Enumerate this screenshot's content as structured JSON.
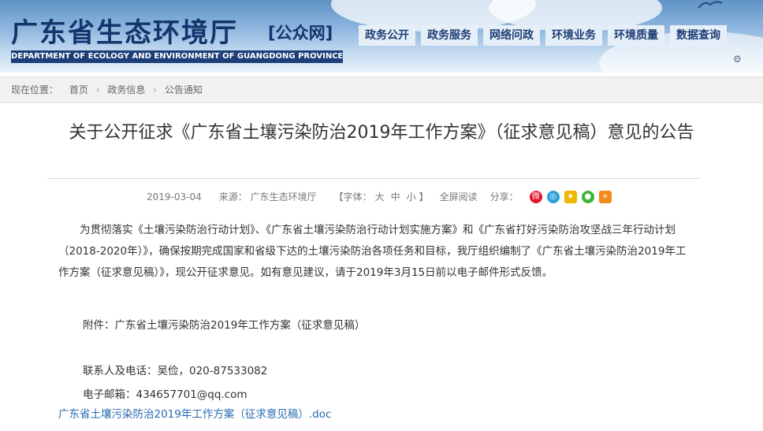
{
  "header": {
    "site_title": "广东省生态环境厅",
    "site_sub": "[公众网]",
    "site_en": "DEPARTMENT OF ECOLOGY AND ENVIRONMENT OF GUANGDONG PROVINCE",
    "nav": [
      "政务公开",
      "政务服务",
      "网络问政",
      "环境业务",
      "环境质量",
      "数据查询"
    ]
  },
  "breadcrumb": {
    "lead": "现在位置：",
    "items": [
      "首页",
      "政务信息",
      "公告通知"
    ],
    "sep": "›"
  },
  "article": {
    "title": "关于公开征求《广东省土壤污染防治2019年工作方案》（征求意见稿）意见的公告",
    "date": "2019-03-04",
    "source": "来源： 广东生态环境厅",
    "font_label": "【字体：",
    "font_big": "大",
    "font_mid": "中",
    "font_small": "小",
    "font_end": "】",
    "fullscreen": "全屏阅读",
    "share_label": "分享：",
    "share_icons": [
      "weibo-icon",
      "tencent-weibo-icon",
      "qzone-icon",
      "wechat-icon",
      "more-icon"
    ],
    "paragraph": "为贯彻落实《土壤污染防治行动计划》、《广东省土壤污染防治行动计划实施方案》和《广东省打好污染防治攻坚战三年行动计划（2018-2020年）》，确保按期完成国家和省级下达的土壤污染防治各项任务和目标，我厅组织编制了《广东省土壤污染防治2019年工作方案（征求意见稿）》，现公开征求意见。如有意见建议，请于2019年3月15日前以电子邮件形式反馈。",
    "attachment": "附件：广东省土壤污染防治2019年工作方案（征求意见稿）",
    "contact": "联系人及电话：吴俭，020-87533082",
    "email": "电子邮箱：434657701@qq.com",
    "doc_link": "广东省土壤污染防治2019年工作方案（征求意见稿）.doc"
  }
}
